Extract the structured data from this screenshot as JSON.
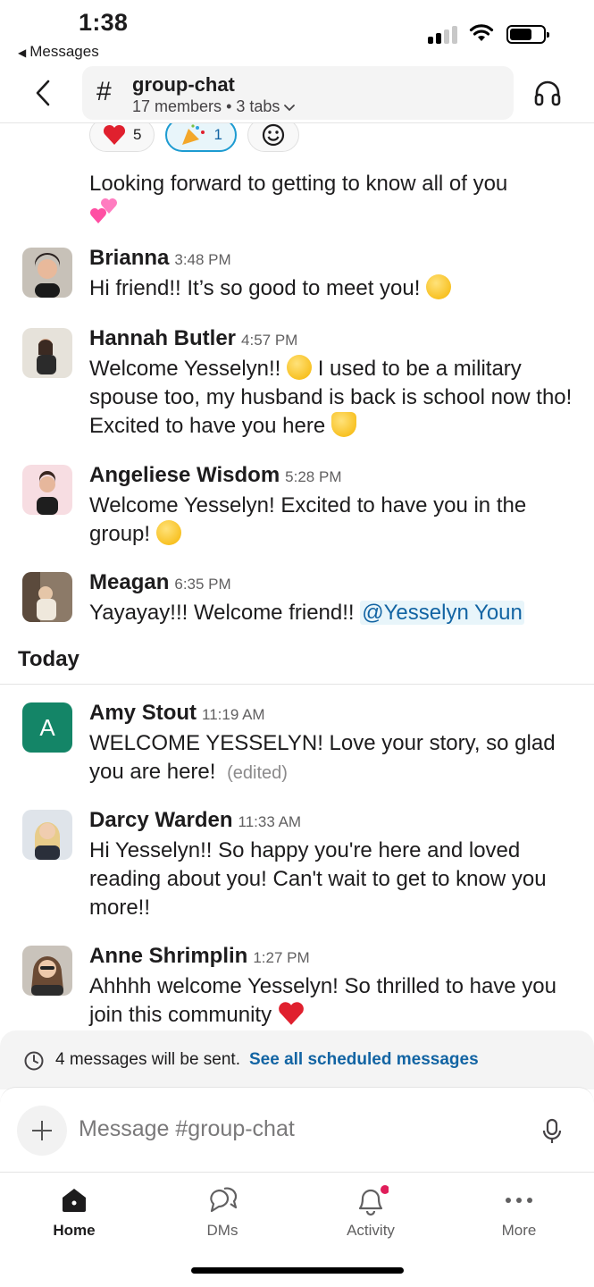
{
  "status_bar": {
    "time": "1:38",
    "back_app": "Messages"
  },
  "header": {
    "channel_name": "group-chat",
    "hash_symbol": "#",
    "members": "17 members",
    "separator": "•",
    "tabs": "3 tabs"
  },
  "reactions": [
    {
      "emoji": "heart-emoji",
      "count": "5",
      "active": false
    },
    {
      "emoji": "party-popper-emoji",
      "count": "1",
      "active": true
    },
    {
      "emoji": "add-reaction-icon",
      "count": "",
      "active": false
    }
  ],
  "continued_message": {
    "text": "Looking forward to getting to know all of you"
  },
  "messages": [
    {
      "name": "Brianna",
      "time": "3:48 PM",
      "text": "Hi friend!! It’s so good to meet you!"
    },
    {
      "name": "Hannah Butler",
      "time": "4:57 PM",
      "text_a": "Welcome Yesselyn!!",
      "text_b": "I used to be a military spouse too, my husband is back is school now tho! Excited to have you here"
    },
    {
      "name": "Angeliese Wisdom",
      "time": "5:28 PM",
      "text": "Welcome Yesselyn! Excited to have you in the group!"
    },
    {
      "name": "Meagan",
      "time": "6:35 PM",
      "text": "Yayayay!!! Welcome friend!!",
      "mention": "@Yesselyn Youn"
    },
    {
      "name": "Amy Stout",
      "time": "11:19 AM",
      "avatar_letter": "A",
      "text": "WELCOME YESSELYN! Love your story, so glad you are here!",
      "edited": "(edited)"
    },
    {
      "name": "Darcy Warden",
      "time": "11:33 AM",
      "text": "Hi Yesselyn!! So happy you're here and loved reading about you! Can't wait to get to know you more!!"
    },
    {
      "name": "Anne Shrimplin",
      "time": "1:27 PM",
      "text": "Ahhhh welcome Yesselyn! So thrilled to have you join this community"
    }
  ],
  "day_divider": "Today",
  "scheduled": {
    "text": "4 messages will be sent.",
    "link": "See all scheduled messages"
  },
  "composer": {
    "placeholder": "Message #group-chat"
  },
  "tabbar": [
    {
      "label": "Home",
      "icon": "home-icon",
      "active": true
    },
    {
      "label": "DMs",
      "icon": "dms-icon",
      "active": false
    },
    {
      "label": "Activity",
      "icon": "bell-icon",
      "active": false,
      "badge_color": "#e01e5a"
    },
    {
      "label": "More",
      "icon": "more-icon",
      "active": false
    }
  ],
  "colors": {
    "accent_link": "#1264a3",
    "amy_avatar": "#148567",
    "notification_dot": "#e01e5a"
  }
}
